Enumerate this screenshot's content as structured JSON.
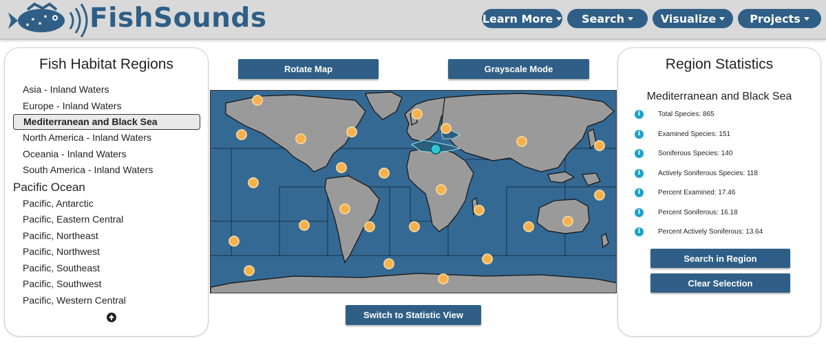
{
  "header": {
    "brand": "FishSounds",
    "nav": [
      {
        "label": "Learn More"
      },
      {
        "label": "Search"
      },
      {
        "label": "Visualize"
      },
      {
        "label": "Projects"
      }
    ]
  },
  "left_panel": {
    "title": "Fish Habitat Regions",
    "items": [
      {
        "label": "Asia - Inland Waters"
      },
      {
        "label": "Europe - Inland Waters"
      },
      {
        "label": "Mediterranean and Black Sea",
        "selected": true
      },
      {
        "label": "North America - Inland Waters"
      },
      {
        "label": "Oceania - Inland Waters"
      },
      {
        "label": "South America - Inland Waters"
      }
    ],
    "group_label": "Pacific Ocean",
    "pacific_items": [
      {
        "label": "Pacific, Antarctic"
      },
      {
        "label": "Pacific, Eastern Central"
      },
      {
        "label": "Pacific, Northeast"
      },
      {
        "label": "Pacific, Northwest"
      },
      {
        "label": "Pacific, Southeast"
      },
      {
        "label": "Pacific, Southwest"
      },
      {
        "label": "Pacific, Western Central"
      }
    ]
  },
  "map": {
    "rotate_label": "Rotate Map",
    "grayscale_label": "Grayscale Mode",
    "switch_label": "Switch to Statistic View"
  },
  "right_panel": {
    "title": "Region Statistics",
    "region_name": "Mediterranean and Black Sea",
    "stats": [
      {
        "label": "Total Species: 865"
      },
      {
        "label": "Examined Species: 151"
      },
      {
        "label": "Soniferous Species: 140"
      },
      {
        "label": "Actively Soniferous Species: 118"
      },
      {
        "label": "Percent Examined: 17.46"
      },
      {
        "label": "Percent Soniferous: 16.18"
      },
      {
        "label": "Percent Actively Soniferous: 13.64"
      }
    ],
    "search_label": "Search in Region",
    "clear_label": "Clear Selection"
  },
  "colors": {
    "brand": "#2f5f86",
    "ocean": "#346993",
    "land": "#9a9a9a",
    "marker": "#f7b04a",
    "selected_marker": "#2ec6d6",
    "info": "#1aa3c9"
  }
}
